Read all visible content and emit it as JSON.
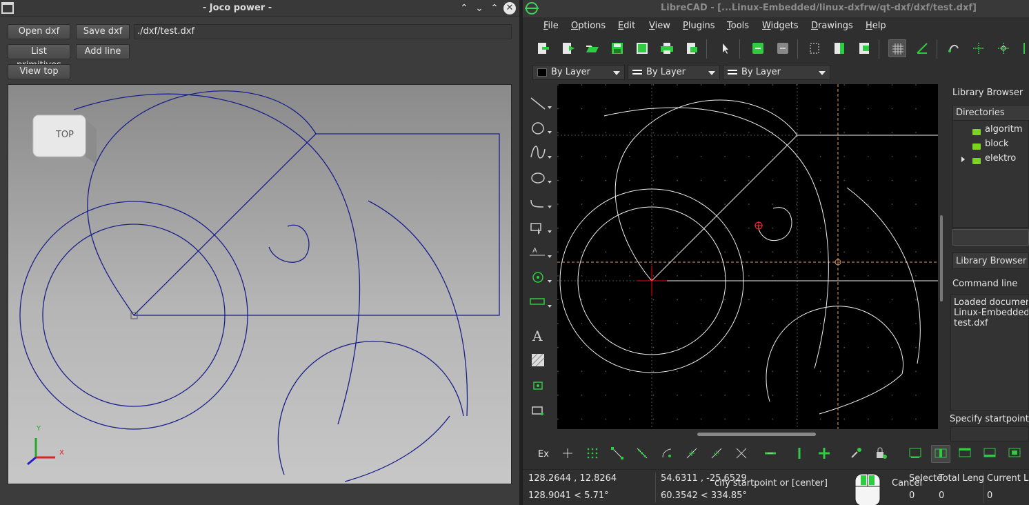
{
  "left_window": {
    "title": "- Joco power -",
    "buttons": {
      "open": "Open dxf",
      "save": "Save dxf",
      "list": "List primitives",
      "add_line": "Add line",
      "view_top": "View top"
    },
    "path_value": "./dxf/test.dxf",
    "view_cube_label": "TOP",
    "axis_labels": {
      "x": "X",
      "y": "Y"
    },
    "window_controls": [
      "shade-icon",
      "minimize-icon",
      "maximize-icon",
      "close-icon"
    ]
  },
  "right_window": {
    "title": "LibreCAD - [...Linux-Embedded/linux-dxfrw/qt-dxf/dxf/test.dxf]",
    "menu": [
      {
        "label": "File",
        "u": "F",
        "rest": "ile"
      },
      {
        "label": "Options",
        "u": "O",
        "rest": "ptions"
      },
      {
        "label": "Edit",
        "u": "E",
        "rest": "dit"
      },
      {
        "label": "View",
        "u": "V",
        "rest": "iew"
      },
      {
        "label": "Plugins",
        "u": "P",
        "rest": "lugins"
      },
      {
        "label": "Tools",
        "u": "T",
        "rest": "ools"
      },
      {
        "label": "Widgets",
        "u": "W",
        "rest": "idgets"
      },
      {
        "label": "Drawings",
        "u": "D",
        "rest": "rawings"
      },
      {
        "label": "Help",
        "u": "H",
        "rest": "elp"
      }
    ],
    "pen": {
      "color": "By Layer",
      "width": "By Layer",
      "linetype": "By Layer"
    },
    "dock": {
      "library_title": "Library Browser",
      "directories_header": "Directories",
      "directories": [
        "algoritm",
        "block",
        "elektro"
      ],
      "library_tab": "Library Browser",
      "command_title": "Command line",
      "command_output": [
        "Loaded documen",
        "Linux-Embedded",
        "test.dxf"
      ],
      "command_prompt": "Specify startpoint"
    },
    "snap_prefix": "Ex",
    "status": {
      "abs_coord": "128.2644 , 12.8264",
      "abs_polar": "128.9041 < 5.71°",
      "rel_coord": "54.6311 , -25.6529",
      "rel_polar": "60.3542 < 334.85°",
      "prompt": "cify startpoint or [center]",
      "cancel": "Cancel",
      "selected_label": "Selecte",
      "selected_value": "0",
      "total_length_label": "Total Leng",
      "total_length_value": "0",
      "current_layer_label": "Current L",
      "current_layer_value": "0"
    },
    "colors": {
      "accent": "#3fd15a",
      "canvas": "#000000",
      "crosshair": "#e8a060",
      "origin": "#ff0000"
    }
  }
}
